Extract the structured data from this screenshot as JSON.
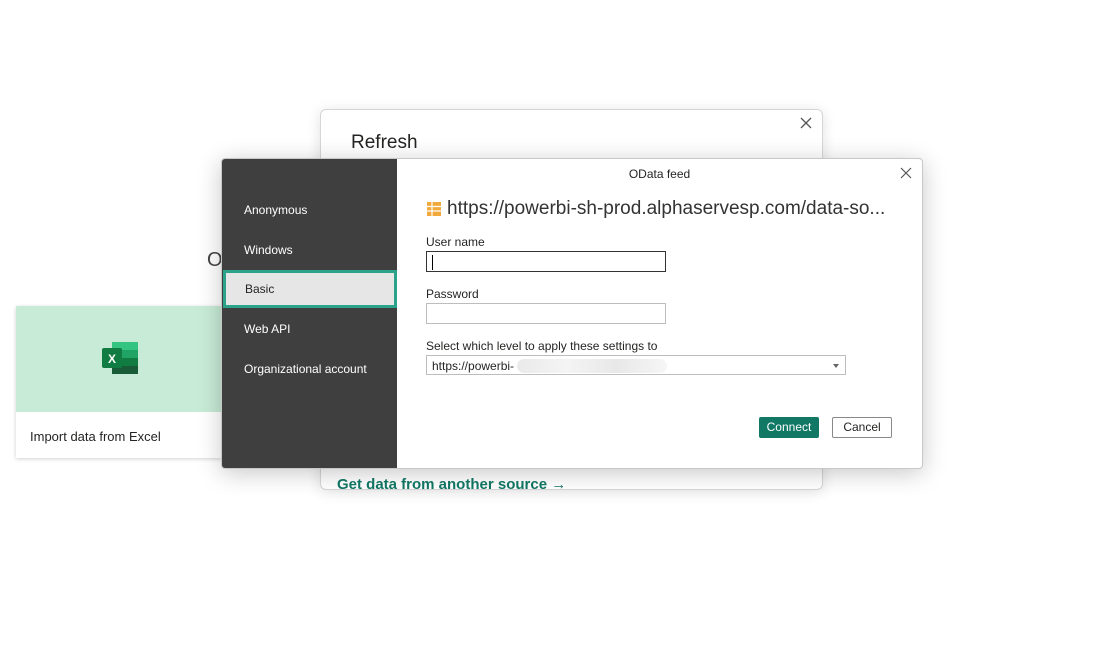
{
  "background": {
    "excel_card_label": "Import data from Excel",
    "stray_letter": "O",
    "refresh_title": "Refresh",
    "get_data_link": "Get data from another source  →"
  },
  "auth_dialog": {
    "title": "OData feed",
    "url": "https://powerbi-sh-prod.alphaservesp.com/data-so...",
    "sidebar": [
      {
        "label": "Anonymous",
        "selected": false
      },
      {
        "label": "Windows",
        "selected": false
      },
      {
        "label": "Basic",
        "selected": true
      },
      {
        "label": "Web API",
        "selected": false
      },
      {
        "label": "Organizational account",
        "selected": false
      }
    ],
    "username_label": "User name",
    "username_value": "",
    "password_label": "Password",
    "password_value": "",
    "level_label": "Select which level to apply these settings to",
    "level_value": "https://powerbi-",
    "connect_label": "Connect",
    "cancel_label": "Cancel"
  },
  "colors": {
    "accent": "#117865",
    "selection_border": "#2aa38a",
    "sidebar_bg": "#3f3f3f",
    "excel_tile_bg": "#c7ebd6"
  },
  "icons": [
    "excel-icon",
    "close-icon",
    "table-icon",
    "chevron-down-icon"
  ]
}
